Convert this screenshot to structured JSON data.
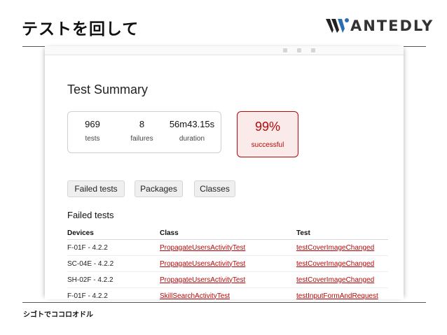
{
  "slide": {
    "title": "テストを回して",
    "logo_text": "ANTEDLY",
    "footer": "シゴトでココロオドル"
  },
  "report": {
    "title": "Test Summary",
    "counters": [
      {
        "value": "969",
        "label": "tests"
      },
      {
        "value": "8",
        "label": "failures"
      },
      {
        "value": "56m43.15s",
        "label": "duration"
      }
    ],
    "success": {
      "value": "99%",
      "label": "successful"
    },
    "tabs": [
      "Failed tests",
      "Packages",
      "Classes"
    ],
    "section_title": "Failed tests",
    "table": {
      "headers": [
        "Devices",
        "Class",
        "Test"
      ],
      "rows": [
        [
          "F-01F - 4.2.2",
          "PropagateUsersActivityTest",
          "testCoverImageChanged"
        ],
        [
          "SC-04E - 4.2.2",
          "PropagateUsersActivityTest",
          "testCoverImageChanged"
        ],
        [
          "SH-02F - 4.2.2",
          "PropagateUsersActivityTest",
          "testCoverImageChanged"
        ],
        [
          "F-01F - 4.2.2",
          "SkillSearchActivityTest",
          "testInputFormAndRequest"
        ]
      ]
    }
  },
  "colors": {
    "accent": "#b60808",
    "success_bg": "#fbeaea",
    "logo_blue": "#2a6fb0"
  }
}
